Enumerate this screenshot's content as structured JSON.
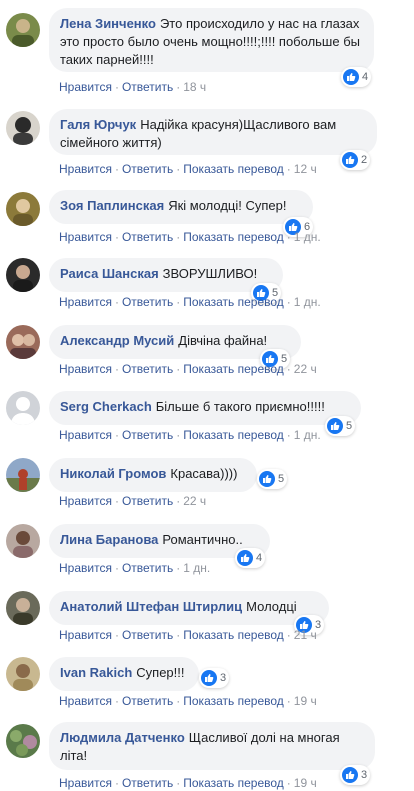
{
  "comments": [
    {
      "author": "Лена Зинченко",
      "text": "Это происходило у нас на глазах это просто было очень мощно!!!!;!!!! побольше бы таких парней!!!!",
      "likes": "4",
      "actions": {
        "like": "Нравится",
        "reply": "Ответить",
        "time": "18 ч"
      },
      "avatar_color": "#7a8b4a"
    },
    {
      "author": "Галя Юрчук",
      "text": "Надійка красуня)Щасливого вам сімейного життя)",
      "likes": "2",
      "actions": {
        "like": "Нравится",
        "reply": "Ответить",
        "translate": "Показать перевод",
        "time": "12 ч"
      },
      "avatar_color": "#3a3a3a"
    },
    {
      "author": "Зоя Паплинская",
      "text": "Які молодці! Супер!",
      "likes": "6",
      "actions": {
        "like": "Нравится",
        "reply": "Ответить",
        "translate": "Показать перевод",
        "time": "1 дн."
      },
      "avatar_color": "#8c7a3a"
    },
    {
      "author": "Раиса Шанская",
      "text": "ЗВОРУШЛИВО!",
      "likes": "5",
      "actions": {
        "like": "Нравится",
        "reply": "Ответить",
        "translate": "Показать перевод",
        "time": "1 дн."
      },
      "avatar_color": "#2a2a2a"
    },
    {
      "author": "Александр Мусий",
      "text": "Дівчіна файна!",
      "likes": "5",
      "actions": {
        "like": "Нравится",
        "reply": "Ответить",
        "translate": "Показать перевод",
        "time": "22 ч"
      },
      "avatar_color": "#9a6a5a"
    },
    {
      "author": "Serg Cherkach",
      "text": "Більше б такого приємно!!!!!",
      "likes": "5",
      "actions": {
        "like": "Нравится",
        "reply": "Ответить",
        "translate": "Показать перевод",
        "time": "1 дн."
      },
      "avatar_color": "#d0d3d8"
    },
    {
      "author": "Николай Громов",
      "text": "Красава))))",
      "likes": "5",
      "actions": {
        "like": "Нравится",
        "reply": "Ответить",
        "time": "22 ч"
      },
      "avatar_color": "#b0402a"
    },
    {
      "author": "Лина Баранова",
      "text": "Романтично..",
      "likes": "4",
      "actions": {
        "like": "Нравится",
        "reply": "Ответить",
        "time": "1 дн."
      },
      "avatar_color": "#8a6a6a"
    },
    {
      "author": "Анатолий Штефан Штирлиц",
      "text": "Молодці",
      "likes": "3",
      "actions": {
        "like": "Нравится",
        "reply": "Ответить",
        "translate": "Показать перевод",
        "time": "21 ч"
      },
      "avatar_color": "#4a4a3a"
    },
    {
      "author": "Ivan Rakich",
      "text": "Супер!!!",
      "likes": "3",
      "actions": {
        "like": "Нравится",
        "reply": "Ответить",
        "translate": "Показать перевод",
        "time": "19 ч"
      },
      "avatar_color": "#a08a5a"
    },
    {
      "author": "Людмила Датченко",
      "text": "Щасливої долі на многая літа!",
      "likes": "3",
      "actions": {
        "like": "Нравится",
        "reply": "Ответить",
        "translate": "Показать перевод",
        "time": "19 ч"
      },
      "avatar_color": "#5a7a4a"
    }
  ],
  "colors": {
    "author": "#385898",
    "bubble": "#f2f3f5",
    "like": "#1877f2",
    "meta": "#90949c"
  },
  "icons": {
    "like": "thumbs-up-icon",
    "avatar": "user-avatar"
  }
}
